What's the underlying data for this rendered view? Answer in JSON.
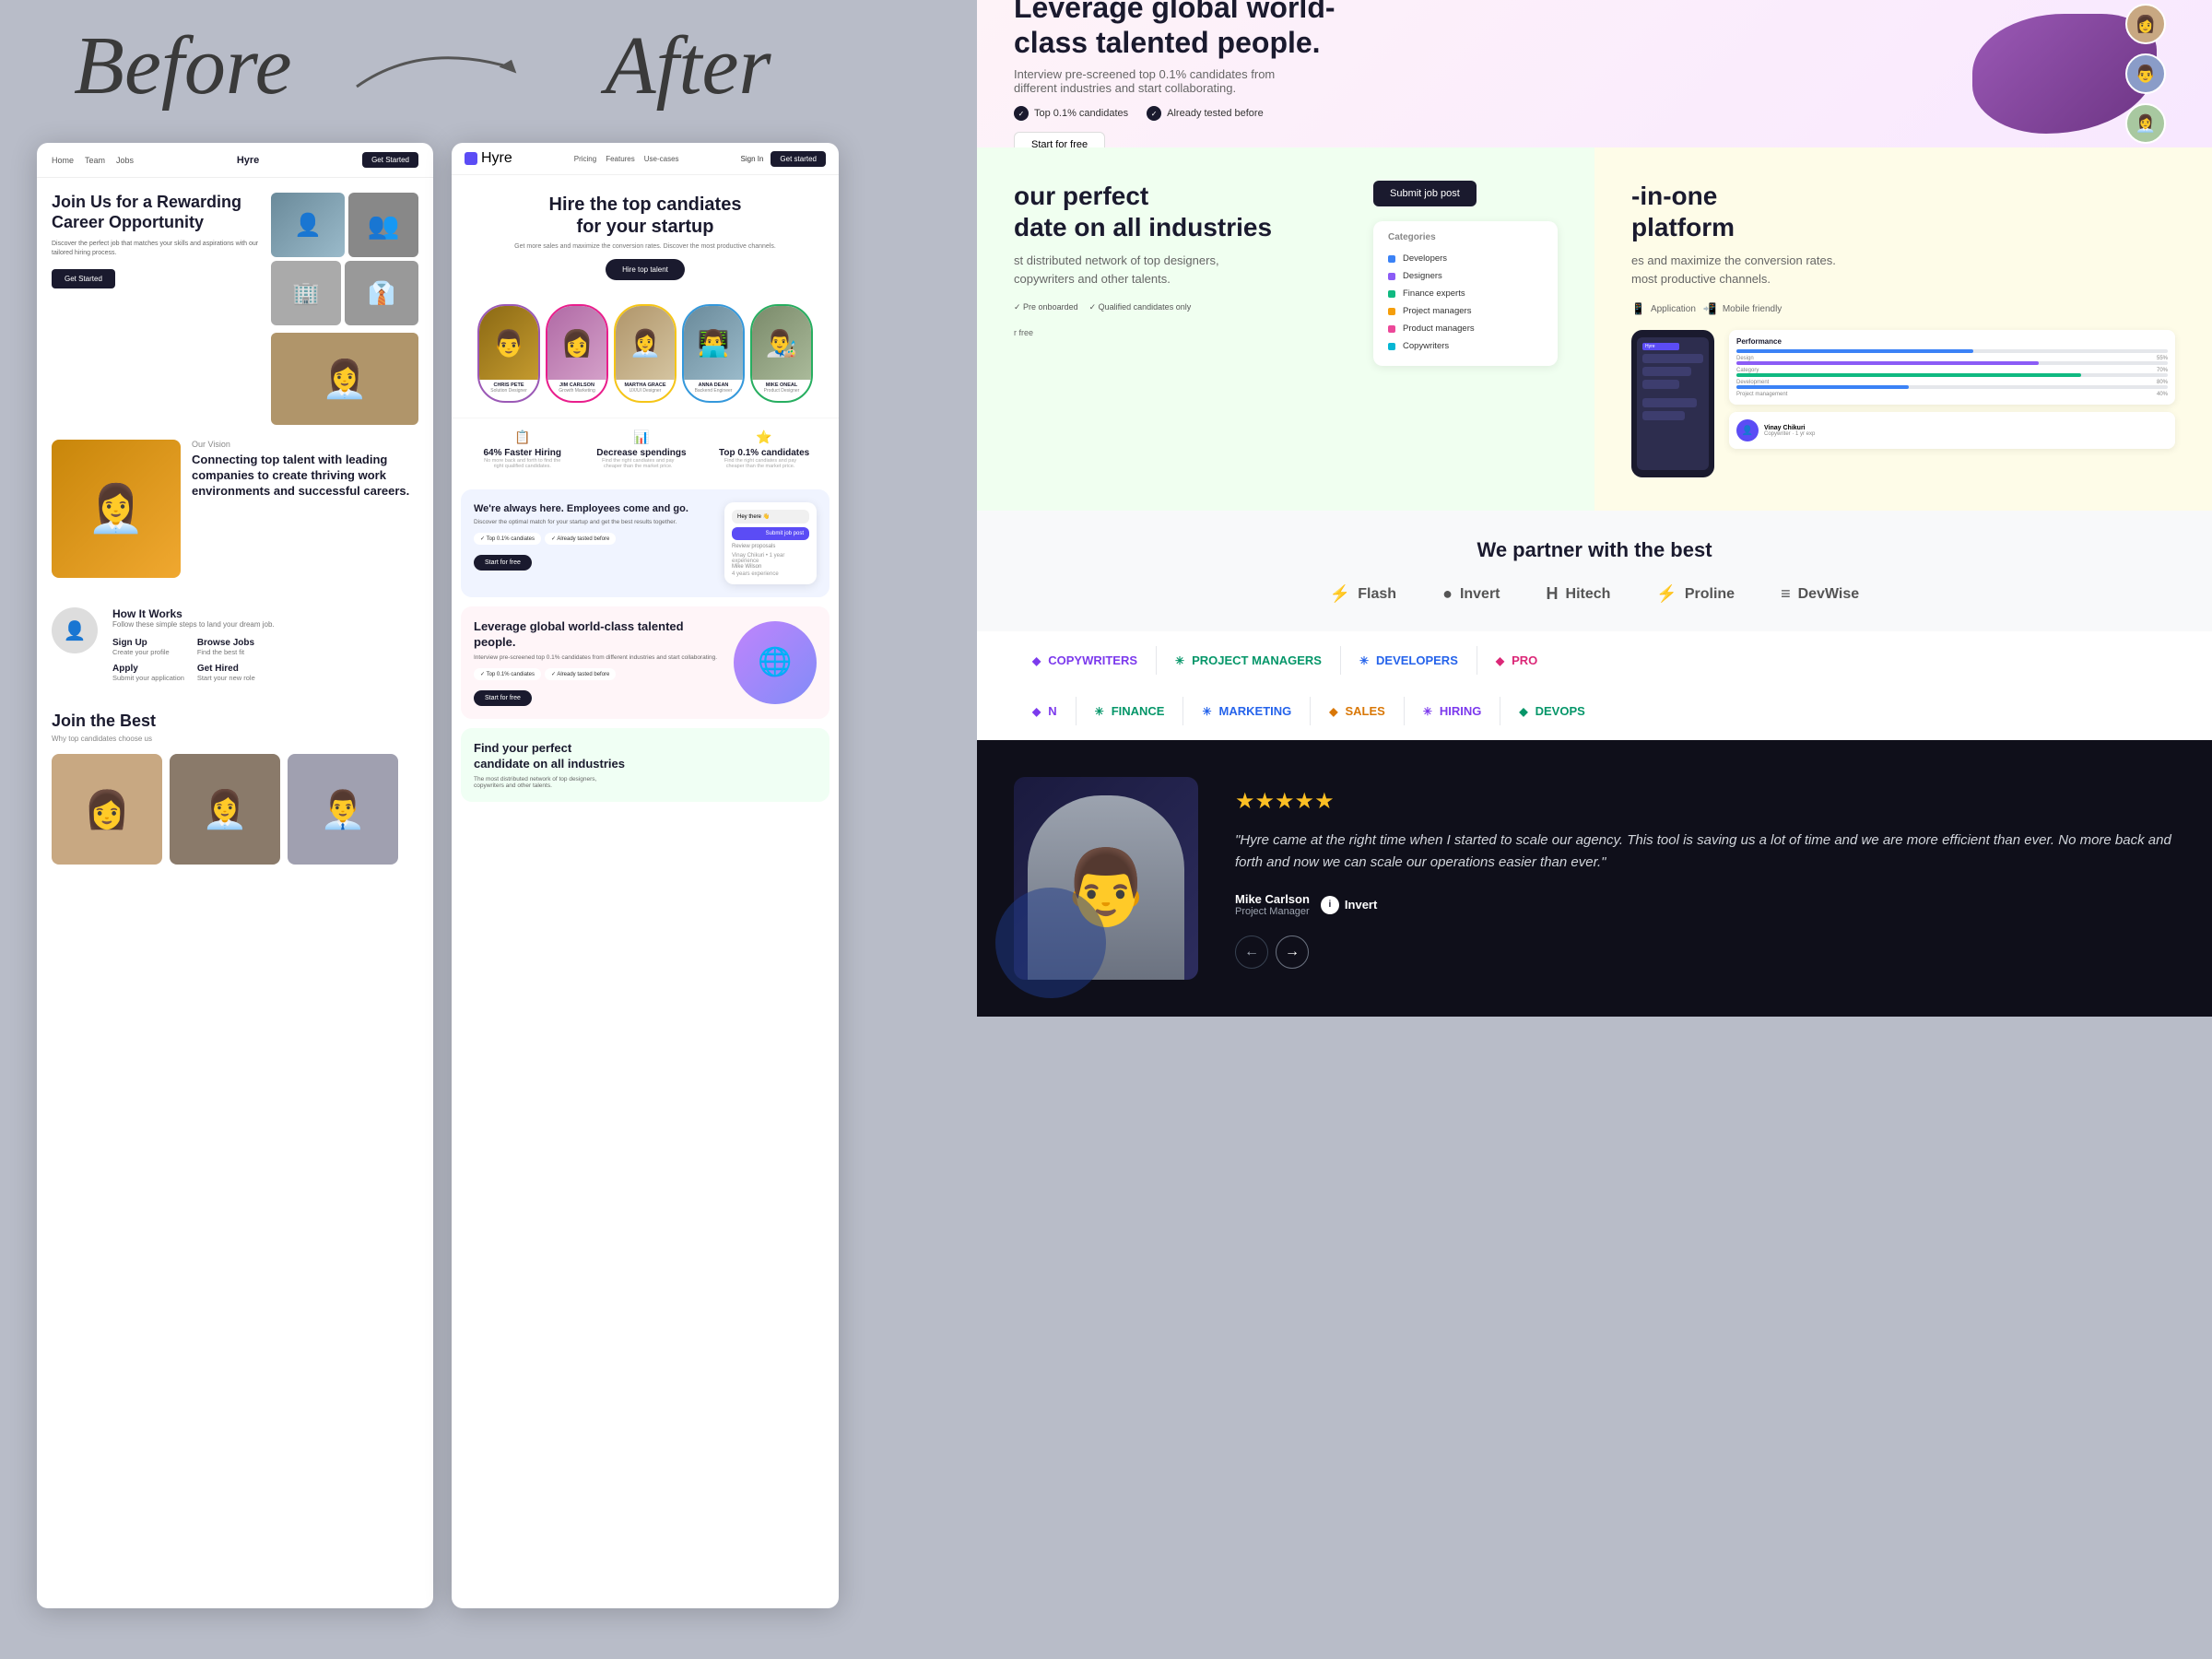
{
  "labels": {
    "before": "Before",
    "after": "After"
  },
  "before_site": {
    "nav": {
      "links": [
        "Home",
        "Team",
        "Jobs"
      ],
      "brand": "Hyre",
      "cta": "Get Started"
    },
    "hero": {
      "title": "Join Us for a Rewarding Career Opportunity",
      "sub": "Discover the perfect job that matches your skills and aspirations with our tailored hiring process.",
      "cta": "Get Started"
    },
    "vision": {
      "label": "Our Vision",
      "title": "Connecting top talent with leading companies to create thriving work environments and successful careers."
    },
    "how_it_works": {
      "title": "How It Works",
      "sub": "Follow these simple steps to land your dream job.",
      "steps": [
        {
          "title": "Sign Up",
          "sub": "Create your profile"
        },
        {
          "title": "Browse Jobs",
          "sub": "Find the best fit"
        },
        {
          "title": "Apply",
          "sub": "Submit your application"
        },
        {
          "title": "Get Hired",
          "sub": "Start your new role"
        }
      ]
    },
    "join": {
      "title": "Join the Best",
      "sub": "Why top candidates choose us"
    }
  },
  "after_site": {
    "nav": {
      "brand": "Hyre",
      "links": [
        "Pricing",
        "Features",
        "Use-cases"
      ],
      "signin": "Sign In",
      "cta": "Get started"
    },
    "hero": {
      "title_prefix": "Hire the ",
      "title_bold": "top candiates",
      "title_suffix": "for your startup",
      "sub": "Get more sales and maximize the conversion rates. Discover the most productive channels.",
      "cta": "Hire top talent"
    },
    "candidates": [
      {
        "name": "CHRIS PETE",
        "role": "Solution Designer",
        "color": "highlight-purple"
      },
      {
        "name": "JIM CARLSON",
        "role": "Growth Marketing",
        "color": "highlight-pink"
      },
      {
        "name": "MARTHA GRACE",
        "role": "UX/UI Designer",
        "color": "highlight-yellow"
      },
      {
        "name": "ANNA DEAN",
        "role": "Backend Engineer",
        "color": "highlight-blue"
      },
      {
        "name": "MIKE ONEAL",
        "role": "Product Designer",
        "color": "highlight-green"
      }
    ],
    "stats": [
      {
        "icon": "📋",
        "value": "64% Faster Hiring",
        "desc": "No more back and forth to find the right qualified candidates."
      },
      {
        "icon": "📊",
        "value": "Decrease spendings",
        "desc": "Find the right candiates and pay cheaper than the market price."
      },
      {
        "icon": "⭐",
        "value": "Top 0.1% candidates",
        "desc": "Find the right candiates and pay cheaper than the market price."
      }
    ],
    "always_here": {
      "title": "We're always here. Employees come and go.",
      "sub": "Discover the optimal match for your startup and get the best results together.",
      "badges": [
        {
          "icon": "✓",
          "label": "Top 0.1% candiates"
        },
        {
          "icon": "✓",
          "label": "Already tasted before"
        }
      ],
      "cta": "Start for free"
    },
    "leverage": {
      "title": "Leverage global world-class talented people.",
      "sub": "Interview pre-screened top 0.1% candidates from different industries and start collaborating.",
      "badges": [
        {
          "icon": "✓",
          "label": "Top 0.1% candiates"
        },
        {
          "icon": "✓",
          "label": "Already tasted before"
        }
      ],
      "cta": "Start for free"
    }
  },
  "hero_banner": {
    "title": "Leverage global world-\nclass talented people.",
    "sub": "Interview pre-screened top 0.1% candidates from\ndifferent industries and start collaborating.",
    "badges": [
      {
        "label": "Top 0.1% candidates"
      },
      {
        "label": "Already tested before"
      }
    ],
    "cta": "Start for free"
  },
  "card_perfect": {
    "title": "Find your perfect\ncandidate on all industries",
    "sub": "The most distributed network of top designers,\ncopywriters and other talents.",
    "features": [
      "Pre onboarded",
      "Qualified candidates only"
    ],
    "cta_label": "Submit job post",
    "categories_header": "Categories",
    "categories": [
      {
        "label": "Developers",
        "color": "dot-blue"
      },
      {
        "label": "Designers",
        "color": "dot-purple"
      },
      {
        "label": "Finance experts",
        "color": "dot-green"
      },
      {
        "label": "Project managers",
        "color": "dot-orange"
      },
      {
        "label": "Product managers",
        "color": "dot-pink"
      },
      {
        "label": "Copywriters",
        "color": "dot-teal"
      }
    ],
    "get_free": "r free"
  },
  "card_platform": {
    "title": "All-in-one\nplatform",
    "sub": "es and maximize the conversion rates.\nmost productive channels.",
    "features": [
      "Application",
      "Mobile friendly"
    ],
    "bars": [
      {
        "label": "Design",
        "value": 55,
        "color": "psc-bar-blue"
      },
      {
        "label": "Category",
        "value": 70,
        "color": "psc-bar-purple"
      },
      {
        "label": "Development",
        "value": 80,
        "color": "psc-bar-green"
      },
      {
        "label": "Project management",
        "value": 40,
        "color": "psc-bar-blue"
      }
    ]
  },
  "partners": {
    "title": "We partner with the best",
    "logos": [
      {
        "icon": "⚡",
        "name": "Flash"
      },
      {
        "icon": "●",
        "name": "Invert"
      },
      {
        "icon": "H",
        "name": "Hitech"
      },
      {
        "icon": "⚡",
        "name": "Proline"
      },
      {
        "icon": "≡",
        "name": "DevWise"
      }
    ]
  },
  "tags_row1": [
    {
      "label": "COPYWRITERS",
      "icon": "◆",
      "color": "tag-purple"
    },
    {
      "label": "PROJECT MANAGERS",
      "icon": "✳",
      "color": "tag-green"
    },
    {
      "label": "DEVELOPERS",
      "icon": "✳",
      "color": "tag-blue"
    },
    {
      "label": "PRO",
      "icon": "◆",
      "color": "tag-pink"
    }
  ],
  "tags_row2": [
    {
      "label": "N",
      "icon": "◆",
      "color": "tag-purple"
    },
    {
      "label": "FINANCE",
      "icon": "✳",
      "color": "tag-green"
    },
    {
      "label": "MARKETING",
      "icon": "✳",
      "color": "tag-blue"
    },
    {
      "label": "SALES",
      "icon": "◆",
      "color": "tag-orange"
    },
    {
      "label": "HIRING",
      "icon": "✳",
      "color": "tag-purple"
    },
    {
      "label": "DEVOPS",
      "icon": "◆",
      "color": "tag-green"
    }
  ],
  "testimonial": {
    "stars": "★★★★★",
    "quote": "\"Hyre came at the right time when I started to scale our agency. This tool is saving us a lot of time and we are more efficient than ever. No more back and forth and now we can scale our operations easier than ever.\"",
    "author_name": "Mike Carlson",
    "author_role": "Project Manager",
    "company": "Invert"
  }
}
